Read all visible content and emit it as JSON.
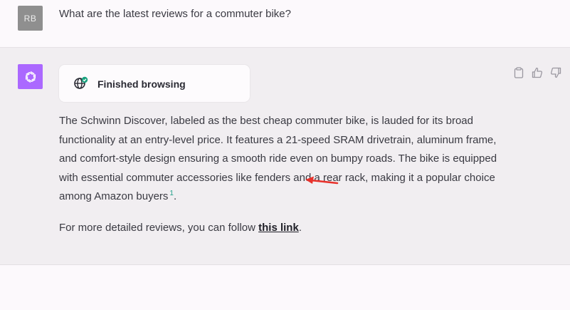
{
  "user_message": {
    "avatar_initials": "RB",
    "text": "What are the latest reviews for a commuter bike?"
  },
  "assistant": {
    "avatar_icon": "openai-logo-icon",
    "browsing_status": "Finished browsing",
    "paragraph1": "The Schwinn Discover, labeled as the best cheap commuter bike, is lauded for its broad functionality at an entry-level price. It features a 21-speed SRAM drivetrain, aluminum frame, and comfort-style design ensuring a smooth ride even on bumpy roads. The bike is equipped with essential commuter accessories like fenders and a rear rack, making it a popular choice among Amazon buyers",
    "citation": "1",
    "paragraph1_end": ".",
    "paragraph2_prefix": "For more detailed reviews, you can follow ",
    "link_text": "this link",
    "paragraph2_suffix": "."
  },
  "actions": [
    "clipboard-icon",
    "thumbs-up-icon",
    "thumbs-down-icon"
  ],
  "colors": {
    "ai_avatar": "#ab68ff",
    "annotation_arrow": "#e8322c",
    "citation": "#20a08a"
  }
}
